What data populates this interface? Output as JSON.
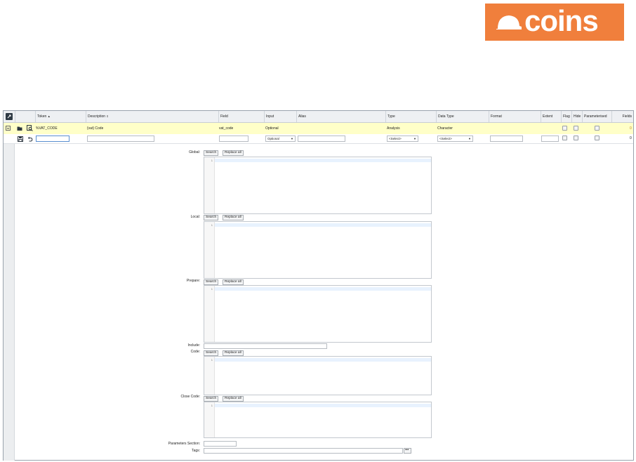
{
  "logo": {
    "text": "coins",
    "color": "#f07f3c",
    "icon": "hard-hat-icon"
  },
  "grid": {
    "columns": [
      "Token",
      "Description",
      "Field",
      "Input",
      "Alias",
      "Type",
      "Data Type",
      "Format",
      "Extent",
      "Flag",
      "Hide",
      "Parameterised",
      "Fields"
    ],
    "sort_indicator_token": "▲",
    "sort_indicator_description": "⇕",
    "row": {
      "token": "%VAT_CODE",
      "description": "{vat} Code",
      "field": "vat_code",
      "input": "Optional",
      "type": "Analysis",
      "data_type": "Character",
      "fields_count": "0"
    },
    "new_row": {
      "input_select": "Optional",
      "type_select": "<Select>",
      "data_type_select": "<Select>",
      "fields_count": "0"
    }
  },
  "form": {
    "global_label": "Global:",
    "local_label": "Local:",
    "prepare_label": "Prepare:",
    "include_label": "Include:",
    "code_label": "Code:",
    "close_code_label": "Close Code:",
    "parameters_label": "Parameters Section:",
    "tags_label": "Tags:",
    "search_label": "Search",
    "replace_label": "Replace all",
    "line_number": "1",
    "tags_button": "•••"
  },
  "colors": {
    "row_highlight": "#ffffc8",
    "header_bg": "#eef0f3",
    "editor_current_line": "#e8f2fe"
  }
}
